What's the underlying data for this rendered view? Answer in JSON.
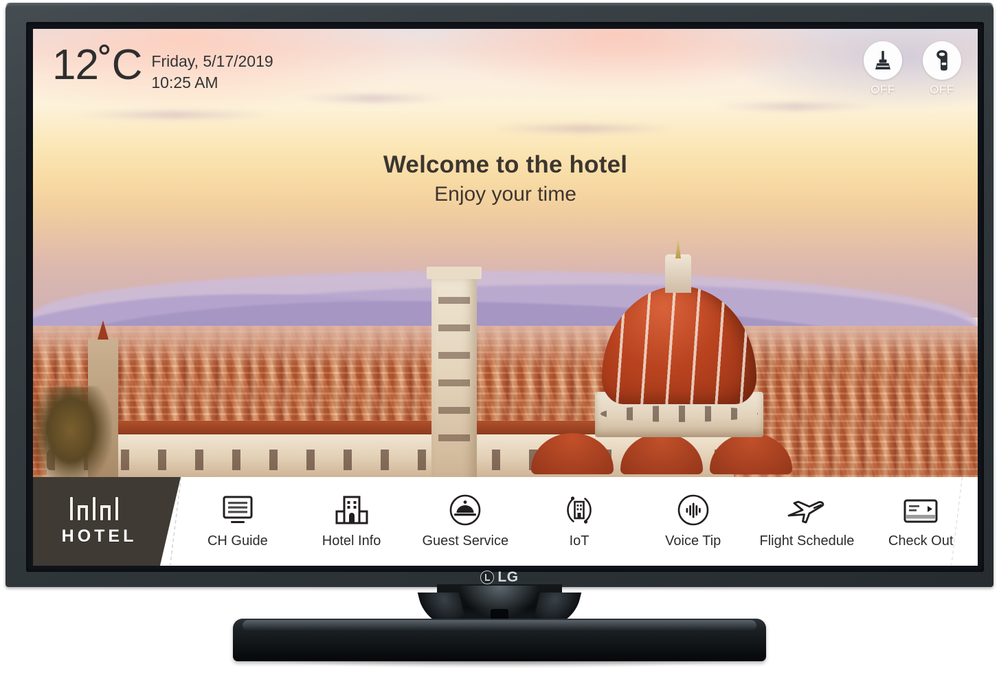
{
  "device": {
    "brand": "LG",
    "brand_mark": "lg-circle-logo"
  },
  "screen": {
    "status_bar": {
      "temperature": "12˚C",
      "date": "Friday, 5/17/2019",
      "time": "10:25 AM",
      "indicators": [
        {
          "icon": "cleaning-service-icon",
          "state_label": "OFF"
        },
        {
          "icon": "do-not-disturb-icon",
          "state_label": "OFF"
        }
      ]
    },
    "welcome": {
      "line1": "Welcome to the hotel",
      "line2": "Enjoy your time"
    },
    "background": {
      "scene": "florence-duomo-sunset-cityscape"
    },
    "menu": {
      "logo": {
        "mark": "hotel-skyline-mark",
        "text": "HOTEL"
      },
      "items": [
        {
          "icon": "channel-guide-icon",
          "label": "CH Guide"
        },
        {
          "icon": "hotel-building-icon",
          "label": "Hotel Info"
        },
        {
          "icon": "service-bell-icon",
          "label": "Guest Service"
        },
        {
          "icon": "iot-building-icon",
          "label": "IoT"
        },
        {
          "icon": "voice-waveform-icon",
          "label": "Voice Tip"
        },
        {
          "icon": "airplane-icon",
          "label": "Flight Schedule"
        },
        {
          "icon": "keycard-icon",
          "label": "Check Out"
        }
      ]
    }
  },
  "colors": {
    "menu_background": "#ffffff",
    "logo_block": "#3f3a34",
    "text_primary": "#2c2c2c",
    "status_label": "#ffffff",
    "bezel": "#3a4247"
  }
}
